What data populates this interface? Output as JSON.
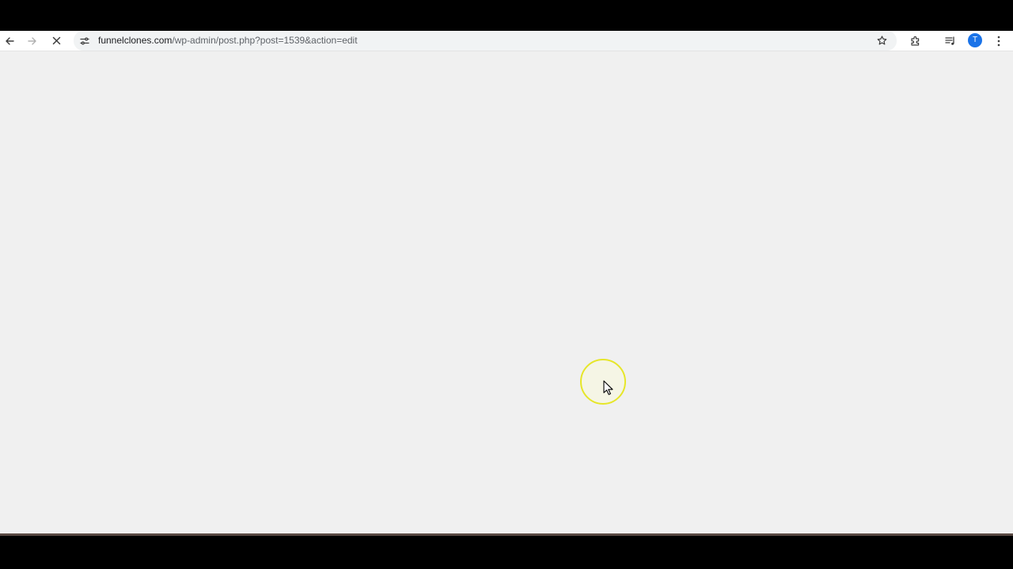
{
  "browser": {
    "url_domain": "funnelclones.com",
    "url_path": "/wp-admin/post.php?post=1539&action=edit",
    "profile_initial": "T",
    "loading": true
  },
  "colors": {
    "page_background": "#f0f0f0",
    "cursor_highlight": "#e6e629",
    "avatar": "#1a73e8"
  },
  "icons": {
    "back": "arrow-left-icon",
    "forward": "arrow-right-icon",
    "stop": "close-icon",
    "site_info": "tune-icon",
    "bookmark": "star-icon",
    "extensions": "puzzle-icon",
    "media": "queue-music-icon",
    "menu": "kebab-menu-icon"
  }
}
